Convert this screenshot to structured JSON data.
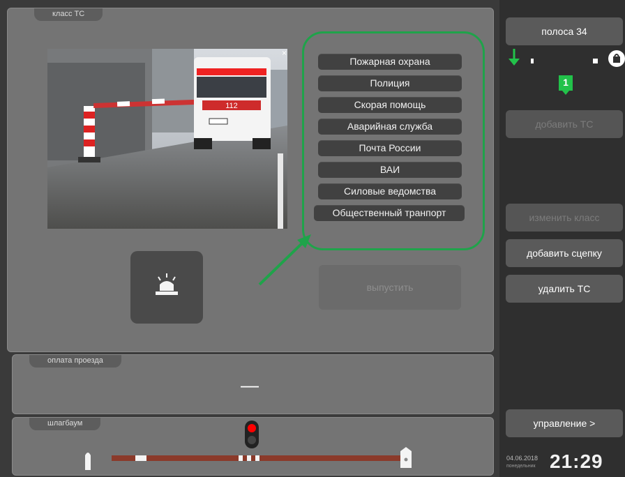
{
  "vehicle_class_panel": {
    "tab_label": "класс ТС",
    "class_options": [
      "Пожарная охрана",
      "Полиция",
      "Скорая помощь",
      "Аварийная служба",
      "Почта России",
      "ВАИ",
      "Силовые ведомства",
      "Общественный транпорт"
    ],
    "close_glyph": "×",
    "release_button_label": "выпустить",
    "highlight_color": "#1fa34a"
  },
  "payment_panel": {
    "tab_label": "оплата проезда",
    "value": "—"
  },
  "barrier_panel": {
    "tab_label": "шлагбаум",
    "barrier_color": "#8b3a2a",
    "light_color": "#ff0000"
  },
  "sidebar": {
    "lane_label": "полоса 34",
    "queue_count": "1",
    "add_vehicle_label": "добавить ТС",
    "change_class_label": "изменить класс",
    "add_trailer_label": "добавить сцепку",
    "delete_vehicle_label": "удалить ТС",
    "control_label": "управление >"
  },
  "footer": {
    "date": "04.06.2018",
    "weekday": "понедельник",
    "time": "21:29"
  }
}
